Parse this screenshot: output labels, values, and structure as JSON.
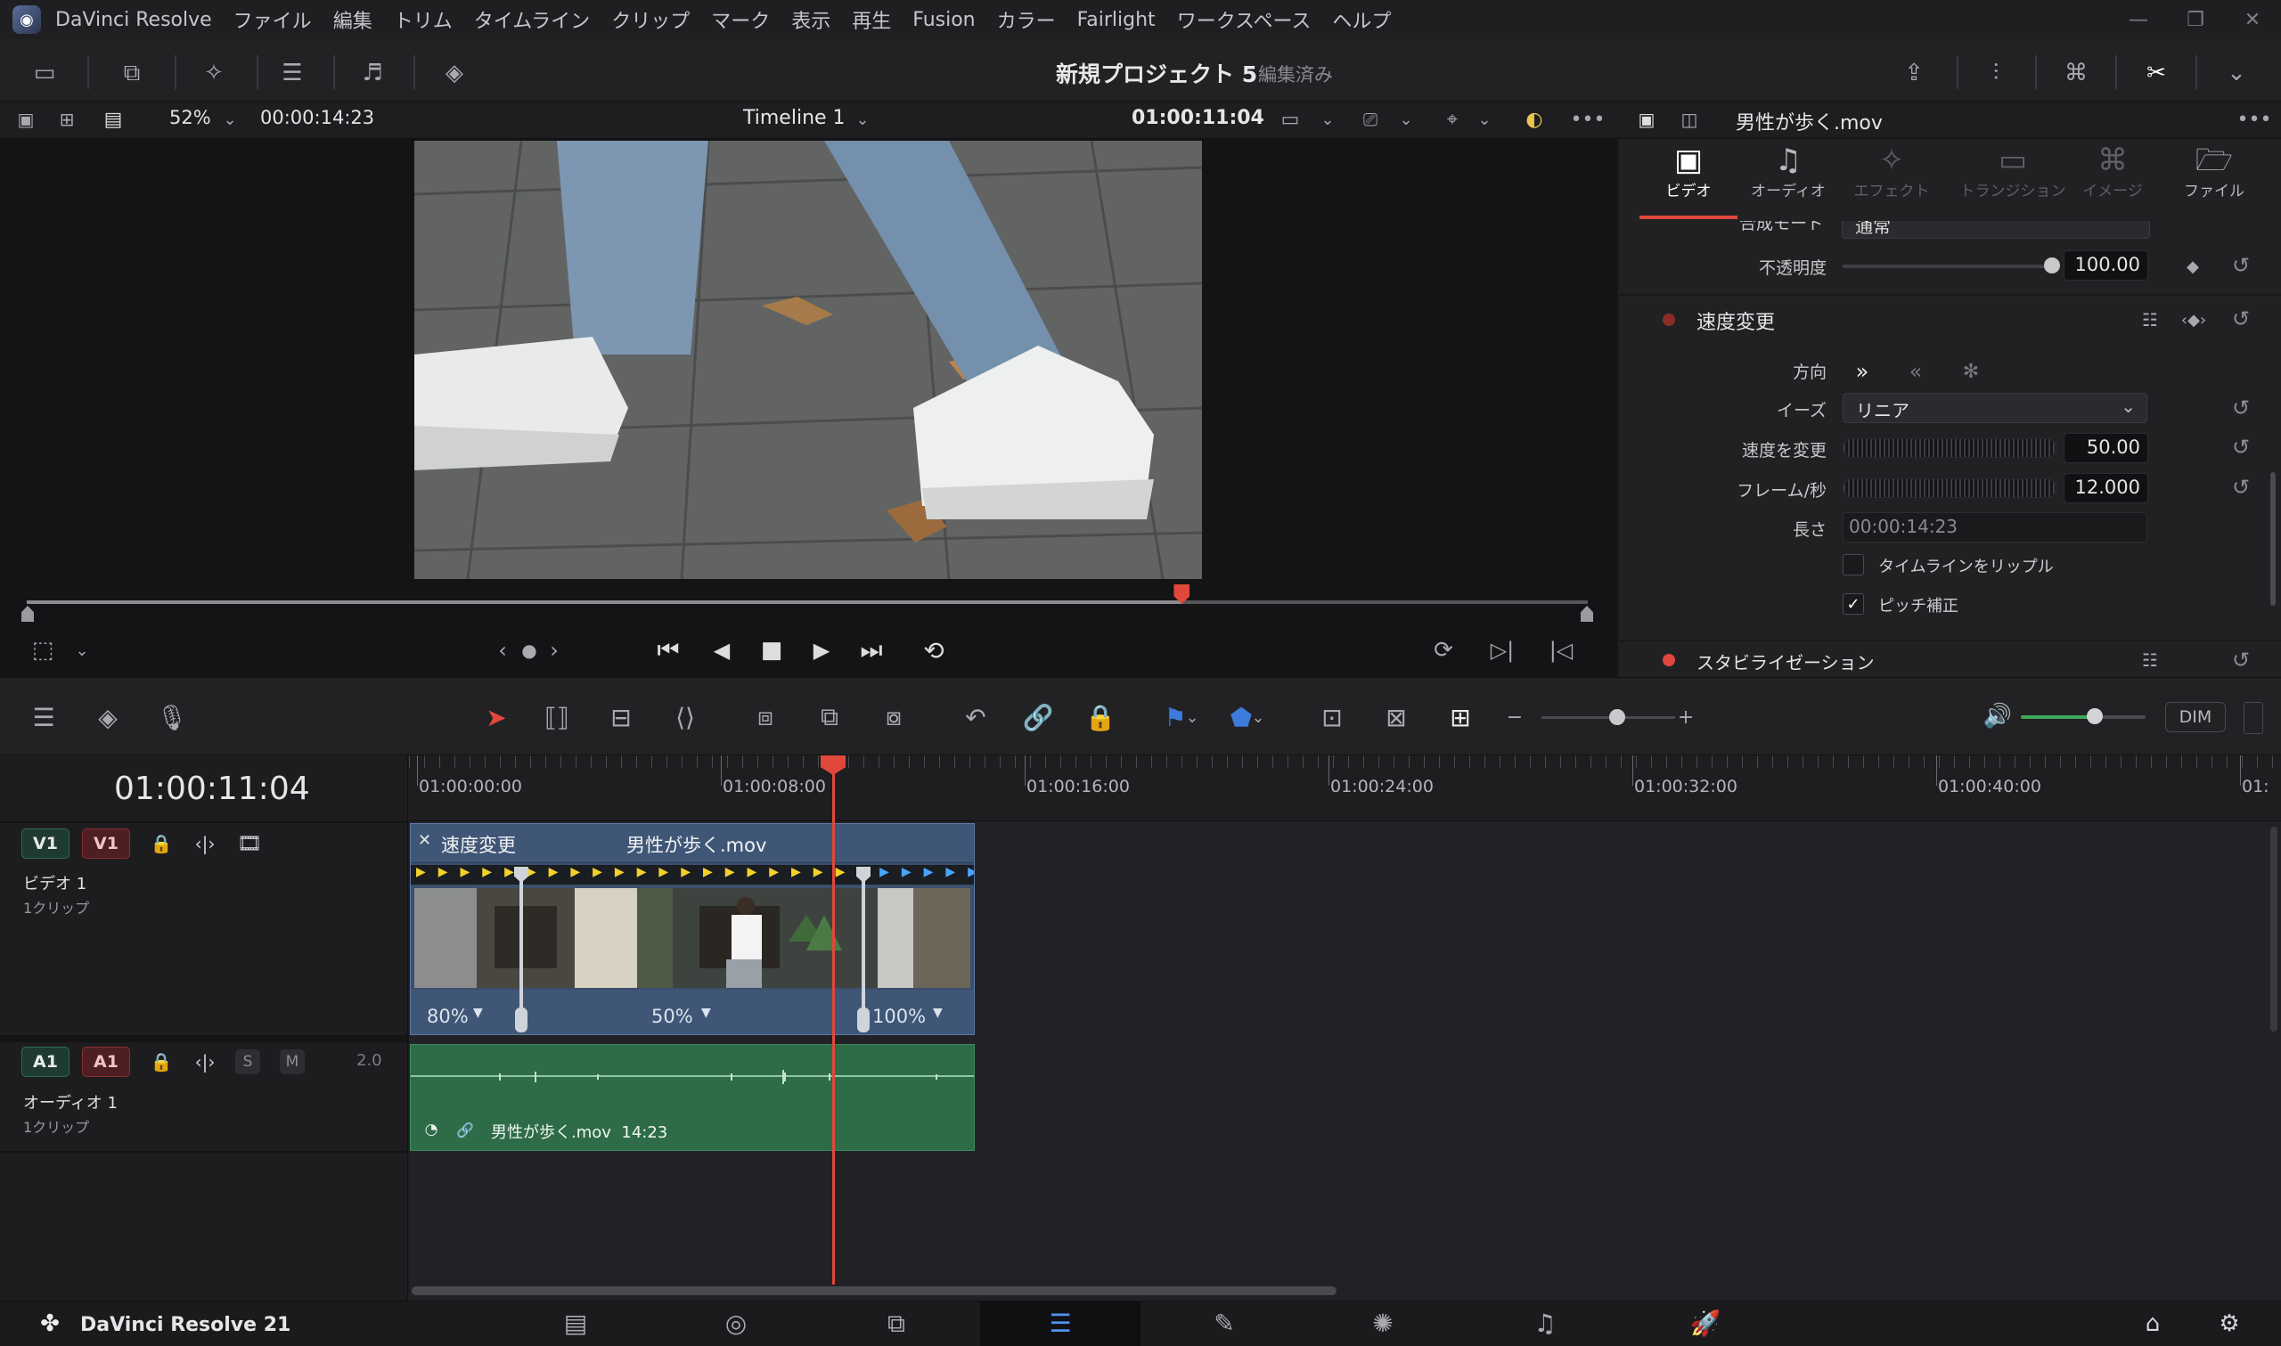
{
  "menubar": {
    "app_name": "DaVinci Resolve",
    "items": [
      "ファイル",
      "編集",
      "トリム",
      "タイムライン",
      "クリップ",
      "マーク",
      "表示",
      "再生",
      "Fusion",
      "カラー",
      "Fairlight",
      "ワークスペース",
      "ヘルプ"
    ]
  },
  "toolbar": {
    "project_title": "新規プロジェクト 5",
    "project_status": "編集済み"
  },
  "viewer": {
    "zoom": "52%",
    "duration": "00:00:14:23",
    "timeline_name": "Timeline 1",
    "timecode": "01:00:11:04",
    "scrub_progress": 0.74
  },
  "inspector": {
    "clip_name": "男性が歩く.mov",
    "tabs": [
      "ビデオ",
      "オーディオ",
      "エフェクト",
      "トランジション",
      "イメージ",
      "ファイル"
    ],
    "composite_mode_label": "合成モード",
    "composite_mode_value": "通常",
    "opacity_label": "不透明度",
    "opacity_value": "100.00",
    "speed_section": "速度変更",
    "direction_label": "方向",
    "ease_label": "イーズ",
    "ease_value": "リニア",
    "speed_label": "速度を変更",
    "speed_value": "50.00",
    "fps_label": "フレーム/秒",
    "fps_value": "12.000",
    "length_label": "長さ",
    "length_value": "00:00:14:23",
    "ripple_label": "タイムラインをリップル",
    "ripple_checked": false,
    "pitch_label": "ピッチ補正",
    "pitch_checked": true,
    "stabilization_section": "スタビライゼーション"
  },
  "timeline_toolbar": {
    "dim_label": "DIM"
  },
  "timeline": {
    "current_tc": "01:00:11:04",
    "ruler_labels": [
      "01:00:00:00",
      "01:00:08:00",
      "01:00:16:00",
      "01:00:24:00",
      "01:00:32:00",
      "01:00:40:00",
      "01:"
    ],
    "video_track": {
      "dest": "V1",
      "source": "V1",
      "name": "ビデオ 1",
      "sub": "1クリップ"
    },
    "audio_track": {
      "dest": "A1",
      "source": "A1",
      "solo": "S",
      "mute": "M",
      "channels": "2.0",
      "name": "オーディオ 1",
      "sub": "1クリップ"
    },
    "video_clip": {
      "close": "✕",
      "effect": "速度変更",
      "name": "男性が歩く.mov",
      "speeds": [
        "80%",
        "50%",
        "100%"
      ]
    },
    "audio_clip": {
      "label": "男性が歩く.mov  14:23"
    }
  },
  "bottombar": {
    "brand": "DaVinci Resolve 21"
  },
  "colors": {
    "accent_red": "#e0483b",
    "video_clip": "#3c4f6c",
    "audio_clip": "#2e6b47",
    "tab_active": "#e0483b"
  }
}
